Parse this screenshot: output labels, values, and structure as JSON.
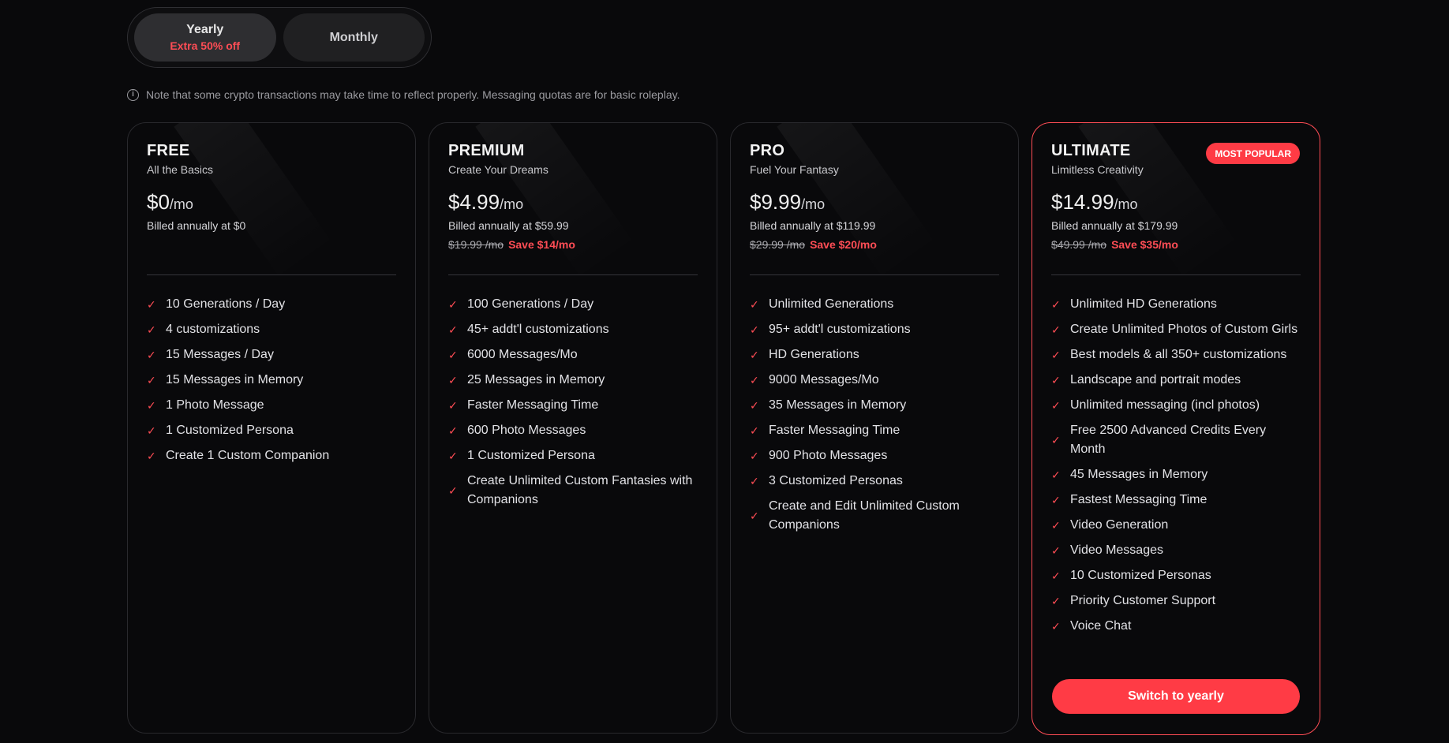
{
  "billing_toggle": {
    "yearly_label": "Yearly",
    "yearly_discount": "Extra 50% off",
    "monthly_label": "Monthly"
  },
  "note": {
    "icon": "info-icon",
    "text": "Note that some crypto transactions may take time to reflect properly. Messaging quotas are for basic roleplay."
  },
  "plans": [
    {
      "name": "FREE",
      "tagline": "All the Basics",
      "price": "$0",
      "period": "/mo",
      "billed": "Billed annually at $0",
      "features": [
        "10 Generations / Day",
        "4 customizations",
        "15 Messages / Day",
        "15 Messages in Memory",
        "1 Photo Message",
        "1 Customized Persona",
        "Create 1 Custom Companion"
      ]
    },
    {
      "name": "PREMIUM",
      "tagline": "Create Your Dreams",
      "price": "$4.99",
      "period": "/mo",
      "billed": "Billed annually at $59.99",
      "original": "$19.99 /mo",
      "save": "Save $14/mo",
      "features": [
        "100 Generations / Day",
        "45+ addt'l customizations",
        "6000 Messages/Mo",
        "25 Messages in Memory",
        "Faster Messaging Time",
        "600 Photo Messages",
        "1 Customized Persona",
        "Create Unlimited Custom Fantasies with Companions"
      ]
    },
    {
      "name": "PRO",
      "tagline": "Fuel Your Fantasy",
      "price": "$9.99",
      "period": "/mo",
      "billed": "Billed annually at $119.99",
      "original": "$29.99 /mo",
      "save": "Save $20/mo",
      "features": [
        "Unlimited Generations",
        "95+ addt'l customizations",
        "HD Generations",
        "9000 Messages/Mo",
        "35 Messages in Memory",
        "Faster Messaging Time",
        "900 Photo Messages",
        "3 Customized Personas",
        "Create and Edit Unlimited Custom Companions"
      ]
    },
    {
      "name": "ULTIMATE",
      "tagline": "Limitless Creativity",
      "badge": "MOST POPULAR",
      "price": "$14.99",
      "period": "/mo",
      "billed": "Billed annually at $179.99",
      "original": "$49.99 /mo",
      "save": "Save $35/mo",
      "cta": "Switch to yearly",
      "features": [
        "Unlimited HD Generations",
        "Create Unlimited Photos of Custom Girls",
        "Best models & all 350+ customizations",
        "Landscape and portrait modes",
        "Unlimited messaging (incl photos)",
        "Free 2500 Advanced Credits Every Month",
        "45 Messages in Memory",
        "Fastest Messaging Time",
        "Video Generation",
        "Video Messages",
        "10 Customized Personas",
        "Priority Customer Support",
        "Voice Chat"
      ]
    }
  ],
  "colors": {
    "accent": "#ff4d55",
    "background": "#09090b",
    "card_border": "#29292d"
  }
}
